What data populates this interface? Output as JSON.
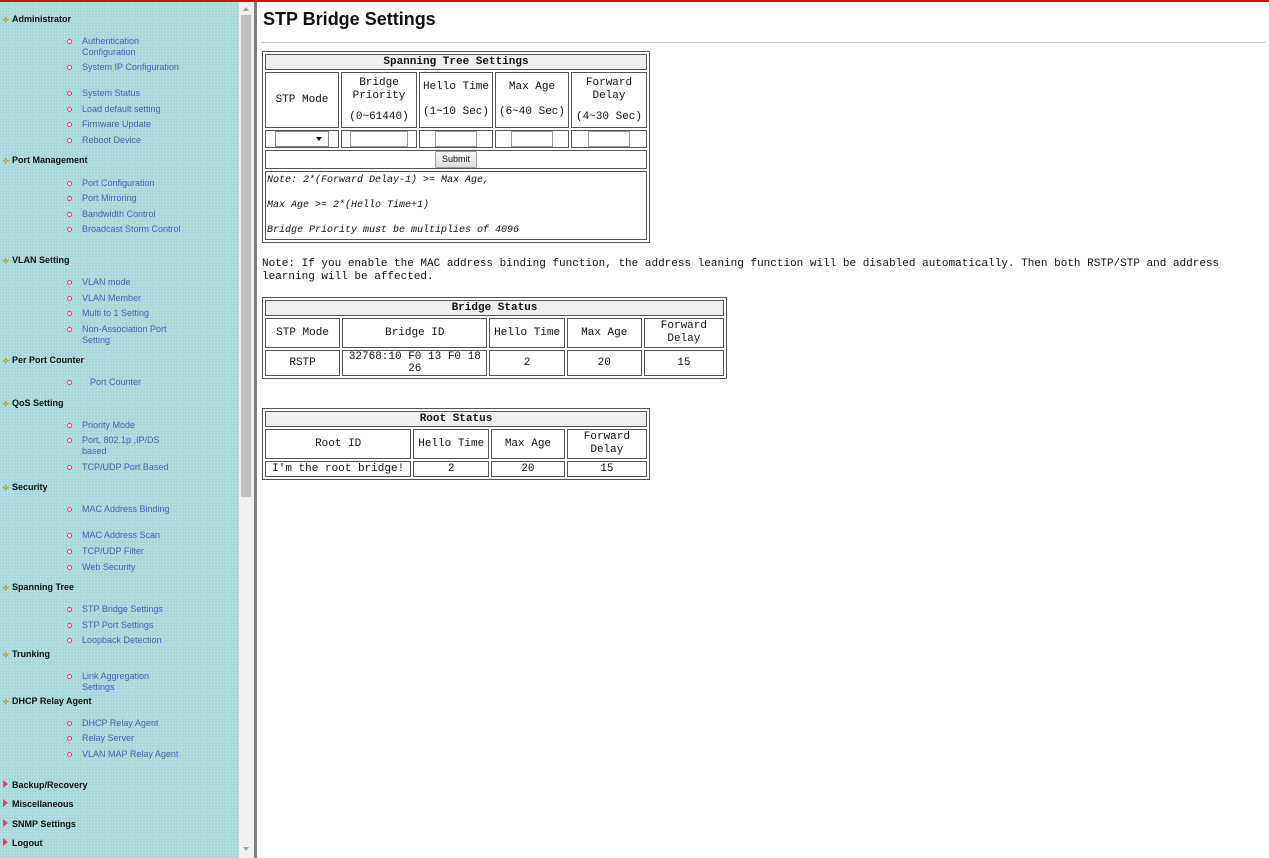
{
  "sidebar": {
    "sections": {
      "administrator": {
        "label": "Administrator",
        "items": [
          "Authentication Configuration",
          "System IP Configuration",
          "System Status",
          "Load default setting",
          "Firmware Update",
          "Reboot Device"
        ]
      },
      "port_management": {
        "label": "Port Management",
        "items": [
          "Port Configuration",
          "Port Mirroring",
          "Bandwidth Control",
          "Broadcast Storm Control"
        ]
      },
      "vlan_setting": {
        "label": "VLAN Setting",
        "items": [
          "VLAN mode",
          "VLAN Member",
          "Multi to 1 Setting",
          "Non-Association Port Setting"
        ]
      },
      "per_port_counter": {
        "label": "Per Port Counter",
        "items": [
          "Port Counter"
        ]
      },
      "qos_setting": {
        "label": "QoS Setting",
        "items": [
          "Priority Mode",
          "Port, 802.1p ,IP/DS based",
          "TCP/UDP Port Based"
        ]
      },
      "security": {
        "label": "Security",
        "items": [
          "MAC Address Binding",
          "MAC Address Scan",
          "TCP/UDP Filter",
          "Web Security"
        ]
      },
      "spanning_tree": {
        "label": "Spanning Tree",
        "items": [
          "STP Bridge Settings",
          "STP Port Settings",
          "Loopback Detection"
        ]
      },
      "trunking": {
        "label": "Trunking",
        "items": [
          "Link Aggregation Settings"
        ]
      },
      "dhcp_relay_agent": {
        "label": "DHCP Relay Agent",
        "items": [
          "DHCP Relay Agent",
          "Relay Server",
          "VLAN MAP Relay Agent"
        ]
      },
      "backup_recovery": {
        "label": "Backup/Recovery"
      },
      "miscellaneous": {
        "label": "Miscellaneous"
      },
      "snmp_settings": {
        "label": "SNMP Settings"
      },
      "logout": {
        "label": "Logout"
      }
    }
  },
  "page": {
    "title": "STP Bridge Settings"
  },
  "stp_settings": {
    "caption": "Spanning Tree Settings",
    "headers": {
      "stp_mode": "STP Mode",
      "bridge_priority": "Bridge Priority",
      "bridge_priority_range": "(0~61440)",
      "hello_time": "Hello Time",
      "hello_time_range": "(1~10 Sec)",
      "max_age": "Max Age",
      "max_age_range": "(6~40 Sec)",
      "forward_delay": "Forward Delay",
      "forward_delay_range": "(4~30 Sec)"
    },
    "values": {
      "stp_mode": "",
      "bridge_priority": "",
      "hello_time": "",
      "max_age": "",
      "forward_delay": ""
    },
    "submit_label": "Submit",
    "notes": [
      "Note: 2*(Forward Delay-1) >= Max Age,",
      "Max Age >= 2*(Hello Time+1)",
      "Bridge Priority must be multiplies of 4096"
    ]
  },
  "binding_note": "Note: If you enable the MAC address binding function, the address leaning function will be disabled automatically. Then both RSTP/STP and address learning will be affected.",
  "bridge_status": {
    "caption": "Bridge Status",
    "headers": [
      "STP Mode",
      "Bridge ID",
      "Hello Time",
      "Max Age",
      "Forward Delay"
    ],
    "row": [
      "RSTP",
      "32768:10 F0 13 F0 18 26",
      "2",
      "20",
      "15"
    ]
  },
  "root_status": {
    "caption": "Root Status",
    "headers": [
      "Root ID",
      "Hello Time",
      "Max Age",
      "Forward Delay"
    ],
    "row": [
      "I'm the root bridge!",
      "2",
      "20",
      "15"
    ]
  },
  "colors": {
    "sidebar_bg": "#a9d8db",
    "link": "#4262b4",
    "top_accent": "#c0151b"
  }
}
